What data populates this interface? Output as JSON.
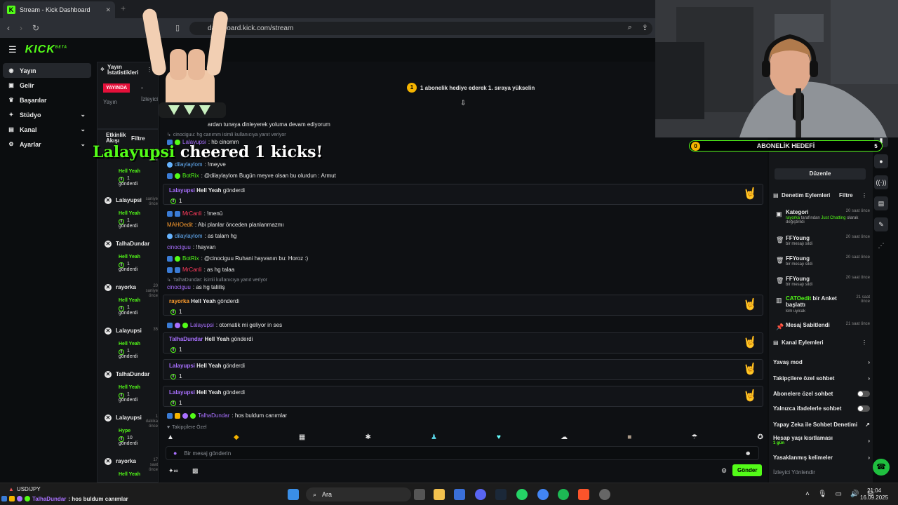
{
  "browser": {
    "tab_title": "Stream - Kick Dashboard",
    "url": "dashboard.kick.com/stream",
    "new_tab": "+"
  },
  "app": {
    "logo": "KICK",
    "logo_badge": "BETA",
    "nav": [
      {
        "label": "Yayın",
        "icon": "broadcast-icon",
        "active": true
      },
      {
        "label": "Gelir",
        "icon": "wallet-icon"
      },
      {
        "label": "Başarılar",
        "icon": "trophy-icon"
      },
      {
        "label": "Stüdyo",
        "icon": "studio-icon",
        "chevron": true
      },
      {
        "label": "Kanal",
        "icon": "channel-icon",
        "chevron": true
      },
      {
        "label": "Ayarlar",
        "icon": "gear-icon",
        "chevron": true
      }
    ]
  },
  "stats": {
    "title": "Yayın İstatistikleri",
    "live": "YAYINDA",
    "dash": "-",
    "yayin_label": "Yayın",
    "izleyici_label": "İzleyici"
  },
  "activity": {
    "title": "Etkinlik Akışı",
    "filter": "Filtre",
    "items": [
      {
        "name": "",
        "time": "önce",
        "type": "Hell Yeah",
        "count": "1",
        "sent": "gönderdi"
      },
      {
        "name": "Lalayupsi",
        "time": "saniye önce",
        "type": "Hell Yeah",
        "count": "1",
        "sent": "gönderdi"
      },
      {
        "name": "TalhaDundar",
        "time": "",
        "type": "Hell Yeah",
        "count": "1",
        "sent": "gönderdi"
      },
      {
        "name": "rayorka",
        "time": "20 saniye önce",
        "type": "Hell Yeah",
        "count": "1",
        "sent": "gönderdi"
      },
      {
        "name": "Lalayupsi",
        "time": "35",
        "type": "Hell Yeah",
        "count": "1",
        "sent": "gönderdi"
      },
      {
        "name": "TalhaDundar",
        "time": "",
        "type": "Hell Yeah",
        "count": "1",
        "sent": "gönderdi"
      },
      {
        "name": "Lalayupsi",
        "time": "1 dakika önce",
        "type": "Hype",
        "count": "10",
        "sent": "gönderdi"
      },
      {
        "name": "rayorka",
        "time": "17 saat önce",
        "type": "Hell Yeah",
        "count": "",
        "sent": ""
      }
    ]
  },
  "chat": {
    "promo": "1 abonelik hediye ederek 1. sıraya yükselin",
    "promo_num": "1",
    "top_line": "ardan tunaya dinleyerek yoluma devam ediyorum",
    "reply1": "cinociguu: hg canımm isimli kullanıcıya yanıt veriyor",
    "m1_user": "Lalayupsi",
    "m1_text": ": hb cinomm",
    "m2_user": "dilaylaylom",
    "m2_text": ": !meyve",
    "m3_user": "BotRix",
    "m3_text": ": @dilaylaylom Bugün meyve olsan bu olurdun : Armut",
    "g1_user": "Lalayupsi",
    "g1_item": "Hell Yeah",
    "g1_sent": "gönderdi",
    "g1_count": "1",
    "m4_user": "MrCanli",
    "m4_text": ": !menü",
    "m5_user": "MAHOedit",
    "m5_text": ": Abi planlar önceden planlanmazmı",
    "m6_user": "dilaylaylom",
    "m6_text": ": as talam hg",
    "m7_user": "cinociguu",
    "m7_text": ": !hayvan",
    "m8_user": "BotRix",
    "m8_text": ": @cinociguu Ruhani hayvanın bu: Horoz :)",
    "m9_user": "MrCanli",
    "m9_text": ": as hg talaa",
    "reply2": "TalhaDundar: isimli kullanıcıya yanıt veriyor",
    "m10_user": "cinociguu",
    "m10_text": ": as hg taliiliş",
    "g2_user": "rayorka",
    "g2_item": "Hell Yeah",
    "g2_sent": "gönderdi",
    "g2_count": "1",
    "m11_user": "Lalayupsi",
    "m11_text": ": otomatik mi geliyor in ses",
    "g3_user": "TalhaDundar",
    "g3_item": "Hell Yeah",
    "g3_sent": "gönderdi",
    "g3_count": "1",
    "g4_user": "Lalayupsi",
    "g4_item": "Hell Yeah",
    "g4_sent": "gönderdi",
    "g4_count": "1",
    "g5_user": "Lalayupsi",
    "g5_item": "Hell Yeah",
    "g5_sent": "gönderdi",
    "g5_count": "1",
    "m12_user": "TalhaDundar",
    "m12_text": ": hos buldum canımlar",
    "subs_only": "Takipçilere Özel",
    "input_placeholder": "Bir mesaj gönderin",
    "send": "Gönder"
  },
  "overlay": {
    "cheer_user": "Lalayupsi",
    "cheer_text": "cheered 1 kicks!",
    "goal_title": "ABONELİK HEDEFİ",
    "goal_left": "0",
    "goal_right": "5"
  },
  "right": {
    "edit_button": "Düzenle",
    "mod_title": "Denetim Eylemleri",
    "mod_filter": "Filtre",
    "mod_items": [
      {
        "title": "Kategori",
        "sub_user": "rayorka",
        "sub_mid": "tarafından",
        "sub_cat": "Just Chatting",
        "sub_end": "olarak değiştirildi",
        "time": "20 saat önce"
      },
      {
        "title": "FFYoung",
        "sub": "bir mesajı sildi",
        "time": "20 saat önce"
      },
      {
        "title": "FFYoung",
        "sub": "bir mesajı sildi",
        "time": "20 saat önce"
      },
      {
        "title": "FFYoung",
        "sub": "bir mesajı sildi",
        "time": "20 saat önce"
      },
      {
        "title_user": "CATOedit",
        "title_rest": "bir Anket başlattı",
        "sub": "kim uyicak",
        "time": "21 saat önce"
      },
      {
        "title": "Mesaj Sabitlendi",
        "time": "21 saat önce"
      }
    ],
    "channel_title": "Kanal Eylemleri",
    "channel_items": [
      {
        "label": "Yavaş mod"
      },
      {
        "label": "Takipçilere özel sohbet"
      },
      {
        "label": "Abonelere özel sohbet"
      },
      {
        "label": "Yalnızca ifadelerle sohbet"
      },
      {
        "label": "Yapay Zeka ile Sohbet Denetimi"
      },
      {
        "label": "Hesap yaşı kısıtlaması",
        "sub": "1 gün"
      },
      {
        "label": "Yasaklanmış kelimeler"
      },
      {
        "label": "İzleyici Yönlendir"
      }
    ]
  },
  "taskbar": {
    "ticker_name": "USD/JPY",
    "ticker_user": "TalhaDundar",
    "ticker_msg": ": hos buldum canımlar",
    "search": "Ara",
    "time": "21:04",
    "date": "16.09.2025"
  }
}
